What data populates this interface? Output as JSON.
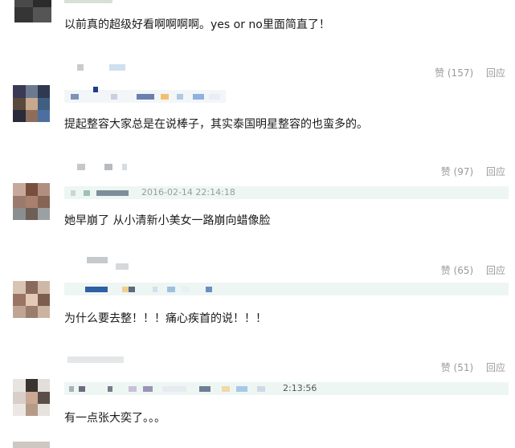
{
  "comments": [
    {
      "text": "以前真的超级好看啊啊啊啊。yes or no里面简直了！"
    },
    {
      "text": "提起整容大家总是在说棒子，其实泰国明星整容的也蛮多的。",
      "likes_label": "赞 (157)",
      "reply_label": "回应"
    },
    {
      "text": "她早崩了 从小清新小美女一路崩向蜡像脸",
      "likes_label": "赞 (97)",
      "reply_label": "回应",
      "timestamp": "2016-02-14 22:14:18"
    },
    {
      "text": "为什么要去整！！！痛心疾首的说！！！",
      "likes_label": "赞 (65)",
      "reply_label": "回应"
    },
    {
      "text": "有一点张大奕了。。。",
      "likes_label": "赞 (51)",
      "reply_label": "回应",
      "timestamp": "2:13:56"
    }
  ],
  "colors": {
    "meta_strip_bg": "#eef6f3",
    "action_text": "#9a9a9a"
  }
}
